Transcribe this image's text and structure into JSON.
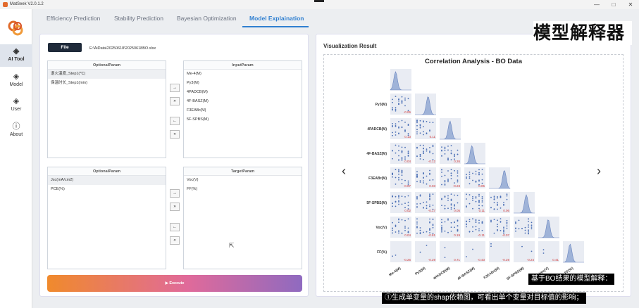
{
  "window": {
    "title": "MatSeek V2.0.1.2",
    "minimize": "—",
    "maximize": "□",
    "close": "✕"
  },
  "sidebar": {
    "items": [
      {
        "label": "AI Tool",
        "icon": "layers-icon",
        "glyph": "◈"
      },
      {
        "label": "Model",
        "icon": "layers-icon",
        "glyph": "◈"
      },
      {
        "label": "User",
        "icon": "layers-icon",
        "glyph": "◈"
      },
      {
        "label": "About",
        "icon": "info-icon",
        "glyph": "ⓘ"
      }
    ]
  },
  "tabs": [
    "Efficiency Prediction",
    "Stability Prediction",
    "Bayesian Optimization",
    "Model Explaination"
  ],
  "left": {
    "file_button": "File",
    "file_path": "E:\\AiData\\20250618\\20250618BO.xlsx",
    "optional1": {
      "header": "OptionalParam",
      "rows": [
        "退火温度_Step1(℃)",
        "保温时长_Step1(min)"
      ]
    },
    "input": {
      "header": "InputParam",
      "rows": [
        "Me-4(M)",
        "Py3(M)",
        "4PADCB(M)",
        "4F-BASZ(M)",
        "F3EABr(M)",
        "5F-SPBS(M)"
      ]
    },
    "optional2": {
      "header": "OptionalParam",
      "rows": [
        "Jsc(mA/cm2)",
        "PCE(%)"
      ]
    },
    "target": {
      "header": "TargetParam",
      "rows": [
        "Voc(V)",
        "FF(%)"
      ]
    },
    "arrows": [
      "→",
      "»",
      "←",
      "«"
    ],
    "execute": "▶ Execute"
  },
  "right": {
    "title": "Visualization Result",
    "prev": "‹",
    "next": "›"
  },
  "chart_data": {
    "type": "scatter",
    "title": "Correlation Analysis - BO Data",
    "variables": [
      "Me-4(M)",
      "Py3(M)",
      "4PADCB(M)",
      "4F-BASZ(M)",
      "F3EABr(M)",
      "5F-SPBS(M)",
      "Voc(V)",
      "FF(%)"
    ],
    "row_labels": [
      "Py3(M)",
      "4PADCB(M)",
      "4F-BASZ(M)",
      "F3EABr(M)",
      "5F-SPBS(M)",
      "Voc(V)",
      "FF(%)"
    ],
    "correlations": [
      [
        "-0.06"
      ],
      [
        "0.13",
        "0.11"
      ],
      [
        "0.04",
        "-0.12",
        "0.26"
      ],
      [
        "-0.07",
        "0.03",
        "-0.23",
        "0.05"
      ],
      [
        "0.02",
        "-0.17",
        "0.05",
        "0.11",
        "0.06"
      ],
      [
        "0.04",
        "-0.81",
        "0.19",
        "-0.11",
        "-0.07",
        ""
      ],
      [
        "-0.26",
        "-0.29",
        "0.71",
        "-0.43",
        "-0.29",
        "-0.24",
        "0.41"
      ]
    ],
    "colors": {
      "points": "#4a6fb5",
      "kde": "#9fb3d8",
      "corr": "#d23c3c",
      "cell": "#e9ecf3"
    }
  },
  "overlay": {
    "title": "模型解释器",
    "caption1": "基于BO结果的模型解释：",
    "caption2": "①生成单变量的shap依赖图，可看出单个变量对目标值的影响；"
  }
}
